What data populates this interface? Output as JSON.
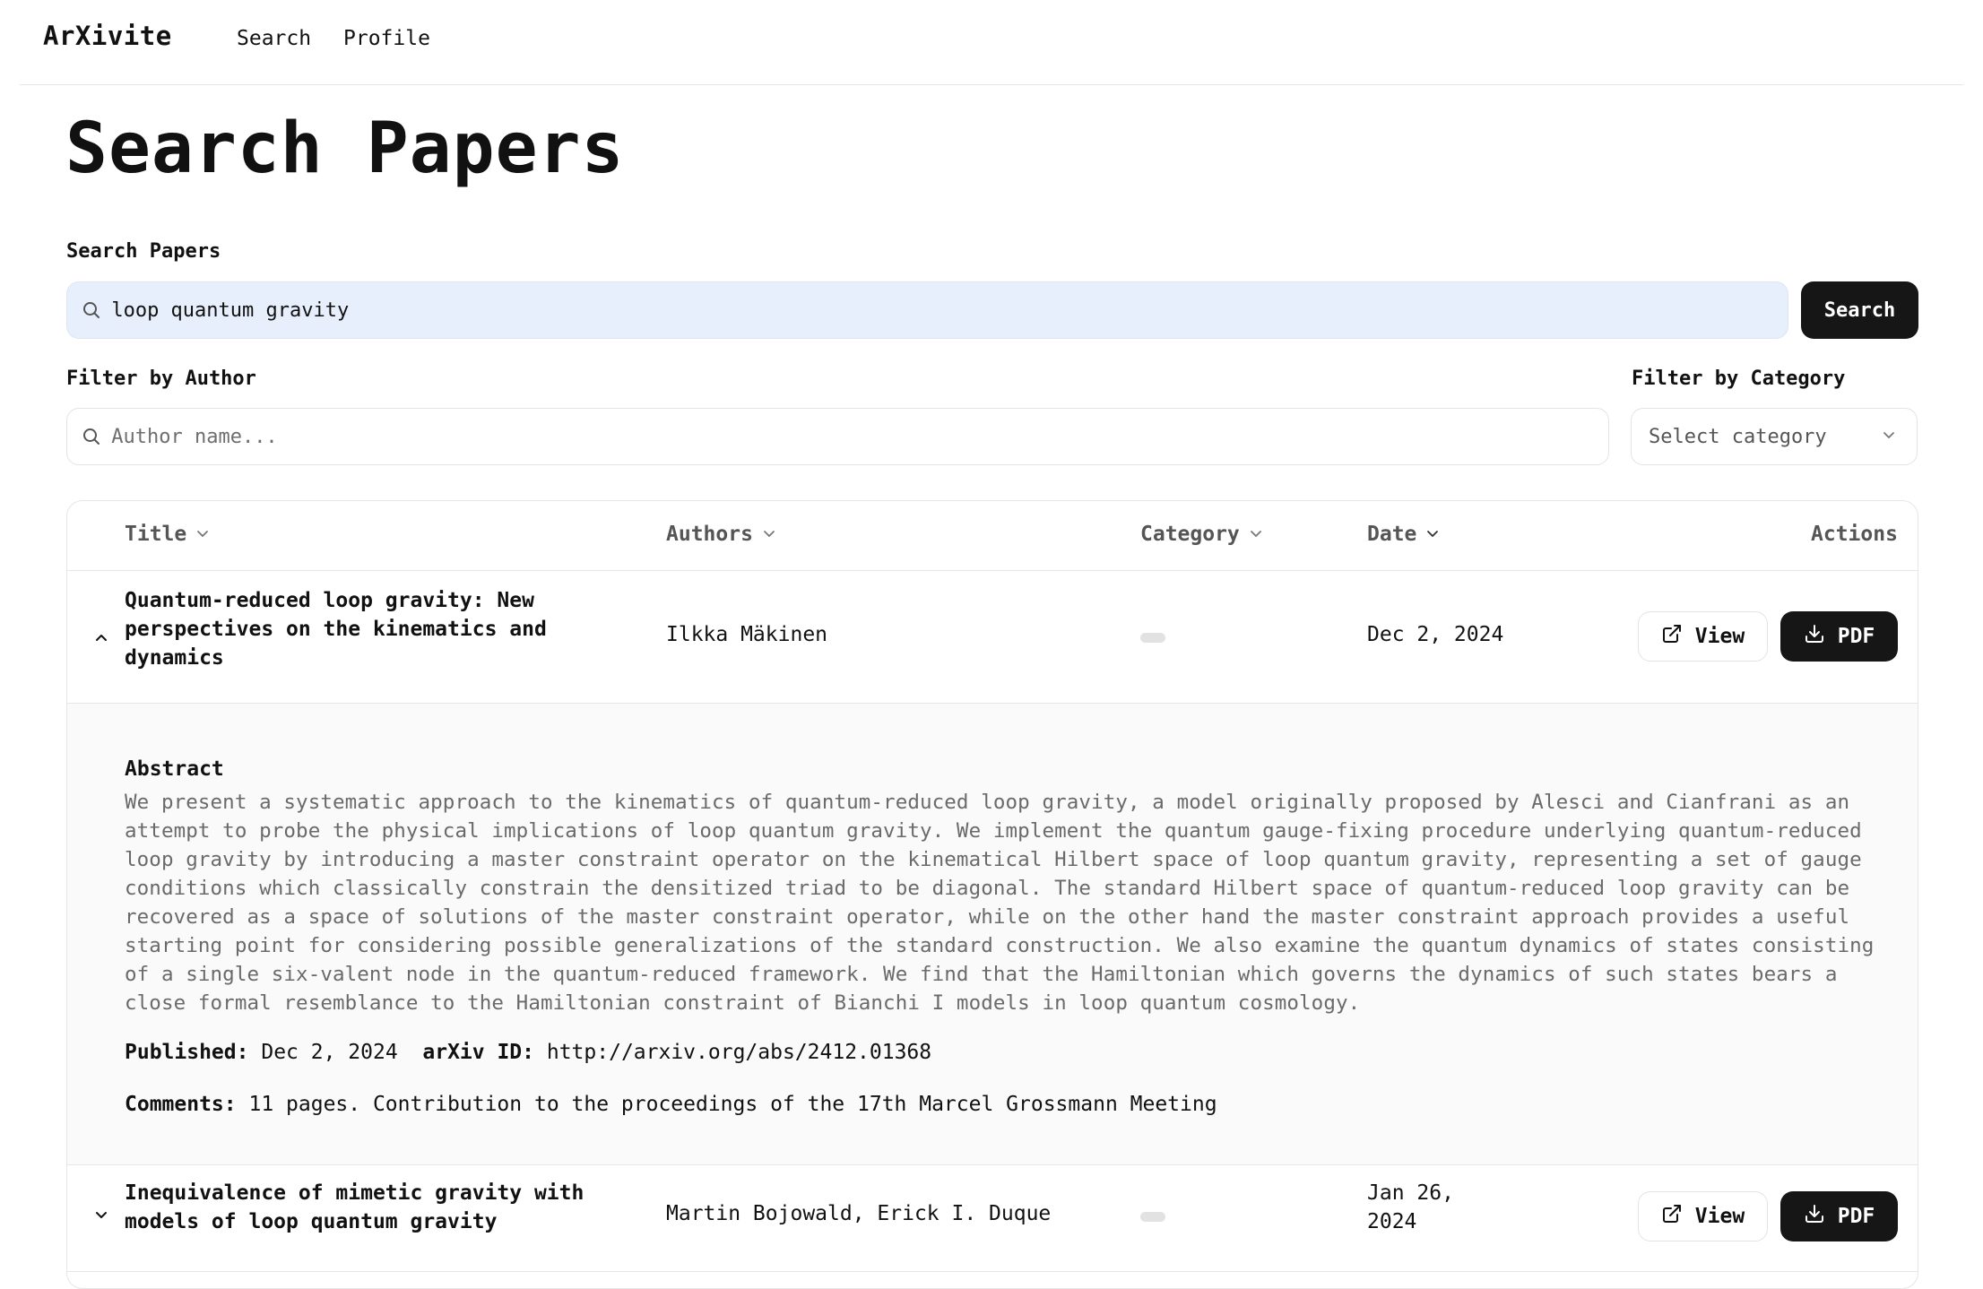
{
  "nav": {
    "brand": "ArXivite",
    "links": [
      "Search",
      "Profile"
    ]
  },
  "page": {
    "title": "Search Papers"
  },
  "search": {
    "label": "Search Papers",
    "value": "loop quantum gravity",
    "button_label": "Search"
  },
  "author_filter": {
    "label": "Filter by Author",
    "placeholder": "Author name..."
  },
  "category_filter": {
    "label": "Filter by Category",
    "selected": "Select category"
  },
  "table": {
    "columns": [
      "Title",
      "Authors",
      "Category",
      "Date",
      "Actions"
    ],
    "rows": [
      {
        "title": "Quantum-reduced loop gravity: New perspectives on the kinematics and dynamics",
        "authors": "Ilkka Mäkinen",
        "date": "Dec 2, 2024",
        "expanded": true,
        "view_label": "View",
        "pdf_label": "PDF"
      },
      {
        "title": "Inequivalence of mimetic gravity with models of loop quantum gravity",
        "authors": "Martin Bojowald, Erick I. Duque",
        "date": "Jan 26, 2024",
        "expanded": false,
        "view_label": "View",
        "pdf_label": "PDF"
      }
    ]
  },
  "detail": {
    "abstract_heading": "Abstract",
    "abstract": "We present a systematic approach to the kinematics of quantum-reduced loop gravity, a model originally proposed by Alesci and Cianfrani as an attempt to probe the physical implications of loop quantum gravity. We implement the quantum gauge-fixing procedure underlying quantum-reduced loop gravity by introducing a master constraint operator on the kinematical Hilbert space of loop quantum gravity, representing a set of gauge conditions which classically constrain the densitized triad to be diagonal. The standard Hilbert space of quantum-reduced loop gravity can be recovered as a space of solutions of the master constraint operator, while on the other hand the master constraint approach provides a useful starting point for considering possible generalizations of the standard construction. We also examine the quantum dynamics of states consisting of a single six-valent node in the quantum-reduced framework. We find that the Hamiltonian which governs the dynamics of such states bears a close formal resemblance to the Hamiltonian constraint of Bianchi I models in loop quantum cosmology.",
    "published_label": "Published:",
    "published_value": "Dec 2, 2024",
    "arxiv_label": "arXiv ID:",
    "arxiv_value": "http://arxiv.org/abs/2412.01368",
    "comments_label": "Comments:",
    "comments_value": "11 pages. Contribution to the proceedings of the 17th Marcel Grossmann Meeting"
  },
  "icons": {
    "search": "search-icon",
    "chevron": "chevron-down-icon",
    "external": "external-link-icon",
    "download": "download-icon"
  },
  "colors": {
    "primary": "#161616",
    "search_bg": "#e8effc",
    "detail_bg": "#fafafa",
    "border": "#e6e6e6"
  }
}
